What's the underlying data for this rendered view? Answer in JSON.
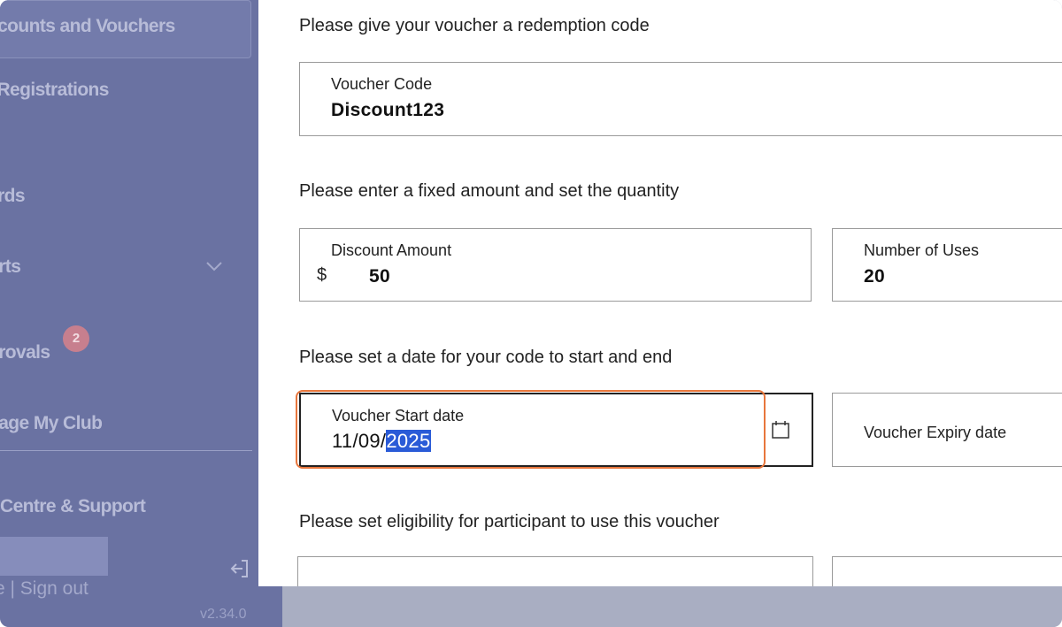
{
  "sidebar": {
    "items": [
      {
        "label": "scounts and Vouchers",
        "active": true
      },
      {
        "label": "l Registrations"
      },
      {
        "label": "ards"
      },
      {
        "label": "orts"
      },
      {
        "label": "provals",
        "badge": "2"
      },
      {
        "label": "nage My Club"
      },
      {
        "label": "Centre & Support"
      }
    ],
    "signout_text": "e | Sign out",
    "version": "v2.34.0"
  },
  "form": {
    "redemption": {
      "title": "Please give your voucher a redemption code",
      "label": "Voucher Code",
      "value": "Discount123"
    },
    "amount": {
      "title": "Please enter a fixed amount and set the quantity",
      "discount_label": "Discount Amount",
      "currency": "$",
      "discount_value": "50",
      "uses_label": "Number of Uses",
      "uses_value": "20"
    },
    "dates": {
      "title": "Please set a date for your code to start and end",
      "start_label": "Voucher Start date",
      "start_value_plain": "11/09/",
      "start_value_selected": "2025",
      "expiry_label": "Voucher Expiry date"
    },
    "eligibility": {
      "title": "Please set eligibility for participant to use this voucher"
    }
  },
  "colors": {
    "sidebar_bg": "#6a72a2",
    "focus": "#e8763c",
    "selection": "#2a5bd7"
  },
  "icons": [
    "chevron-down-icon",
    "calendar-icon",
    "sign-out-icon"
  ]
}
